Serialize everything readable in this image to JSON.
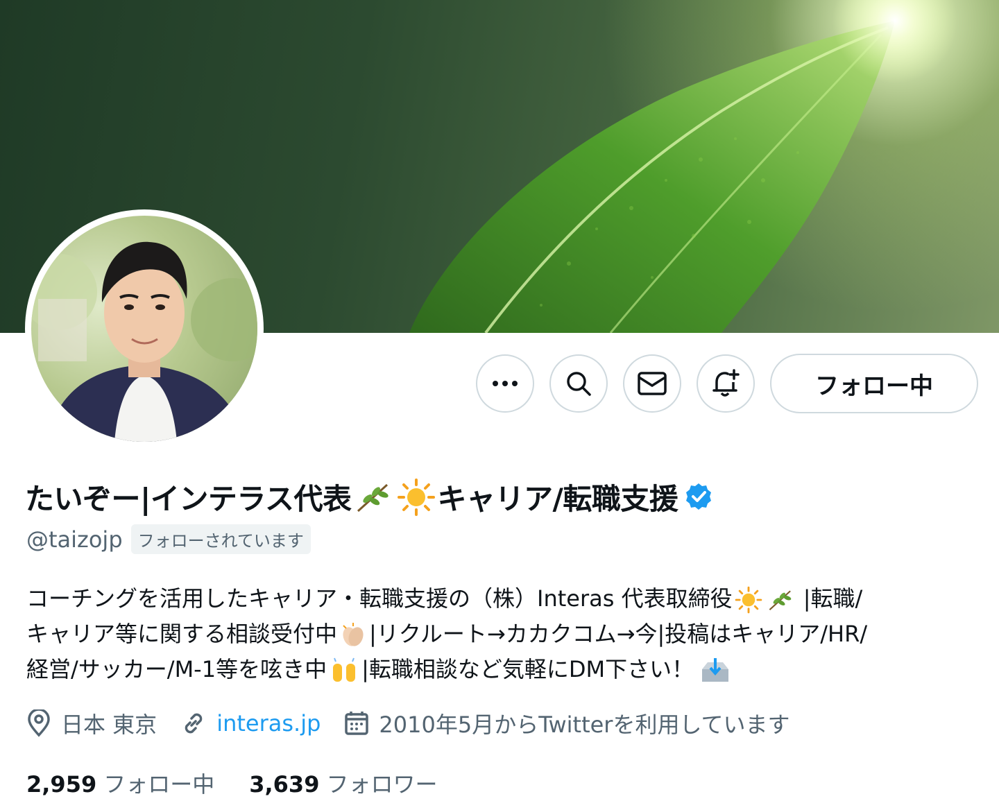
{
  "profile": {
    "name_part1": "たいぞー|インテラス代表",
    "name_part2": "キャリア/転職支援",
    "handle": "@taizojp",
    "follows_you_badge": "フォローされています",
    "verified_color": "#1d9bf0",
    "bio": {
      "line1_a": "コーチングを活用したキャリア・転職支援の（株）Interas 代表取締役",
      "line1_b": " |転職/",
      "line2_a": "キャリア等に関する相談受付中",
      "line2_b": "|リクルート→カカクコム→今|投稿はキャリア/HR/",
      "line3_a": "経営/サッカー/M-1等を呟き中",
      "line3_b": "|転職相談など気軽にDM下さい！"
    },
    "location": "日本 東京",
    "website": "interas.jp",
    "joined": "2010年5月からTwitterを利用しています",
    "following_count": "2,959",
    "following_label": "フォロー中",
    "followers_count": "3,639",
    "followers_label": "フォロワー"
  },
  "actions": {
    "more_icon": "more-icon",
    "search_icon": "search-icon",
    "message_icon": "mail-icon",
    "notify_icon": "bell-plus-icon",
    "follow_label": "フォロー中"
  },
  "colors": {
    "text": "#0f1419",
    "secondary": "#536471",
    "link": "#1d9bf0",
    "border": "#cfd9de"
  }
}
